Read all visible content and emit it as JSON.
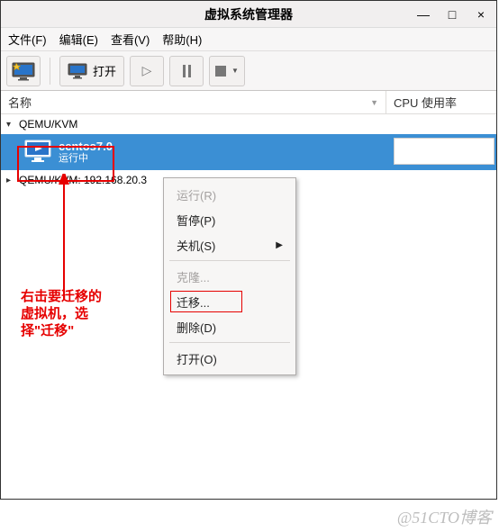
{
  "window": {
    "title": "虚拟系统管理器",
    "min": "—",
    "max": "□",
    "close": "×"
  },
  "menu": {
    "file": "文件(F)",
    "edit": "编辑(E)",
    "view": "查看(V)",
    "help": "帮助(H)"
  },
  "toolbar": {
    "open_label": "打开"
  },
  "columns": {
    "name": "名称",
    "cpu": "CPU 使用率"
  },
  "hosts": [
    {
      "label": "QEMU/KVM"
    },
    {
      "label": "QEMU/KVM: 192.168.20.3"
    }
  ],
  "vm": {
    "name": "centos7.0",
    "status": "运行中"
  },
  "ctx": {
    "run": "运行(R)",
    "pause": "暂停(P)",
    "shutdown": "关机(S)",
    "clone": "克隆...",
    "migrate": "迁移...",
    "delete": "删除(D)",
    "open": "打开(O)"
  },
  "annotation": "右击要迁移的虚拟机，选择\"迁移\"",
  "watermark": "@51CTO博客"
}
